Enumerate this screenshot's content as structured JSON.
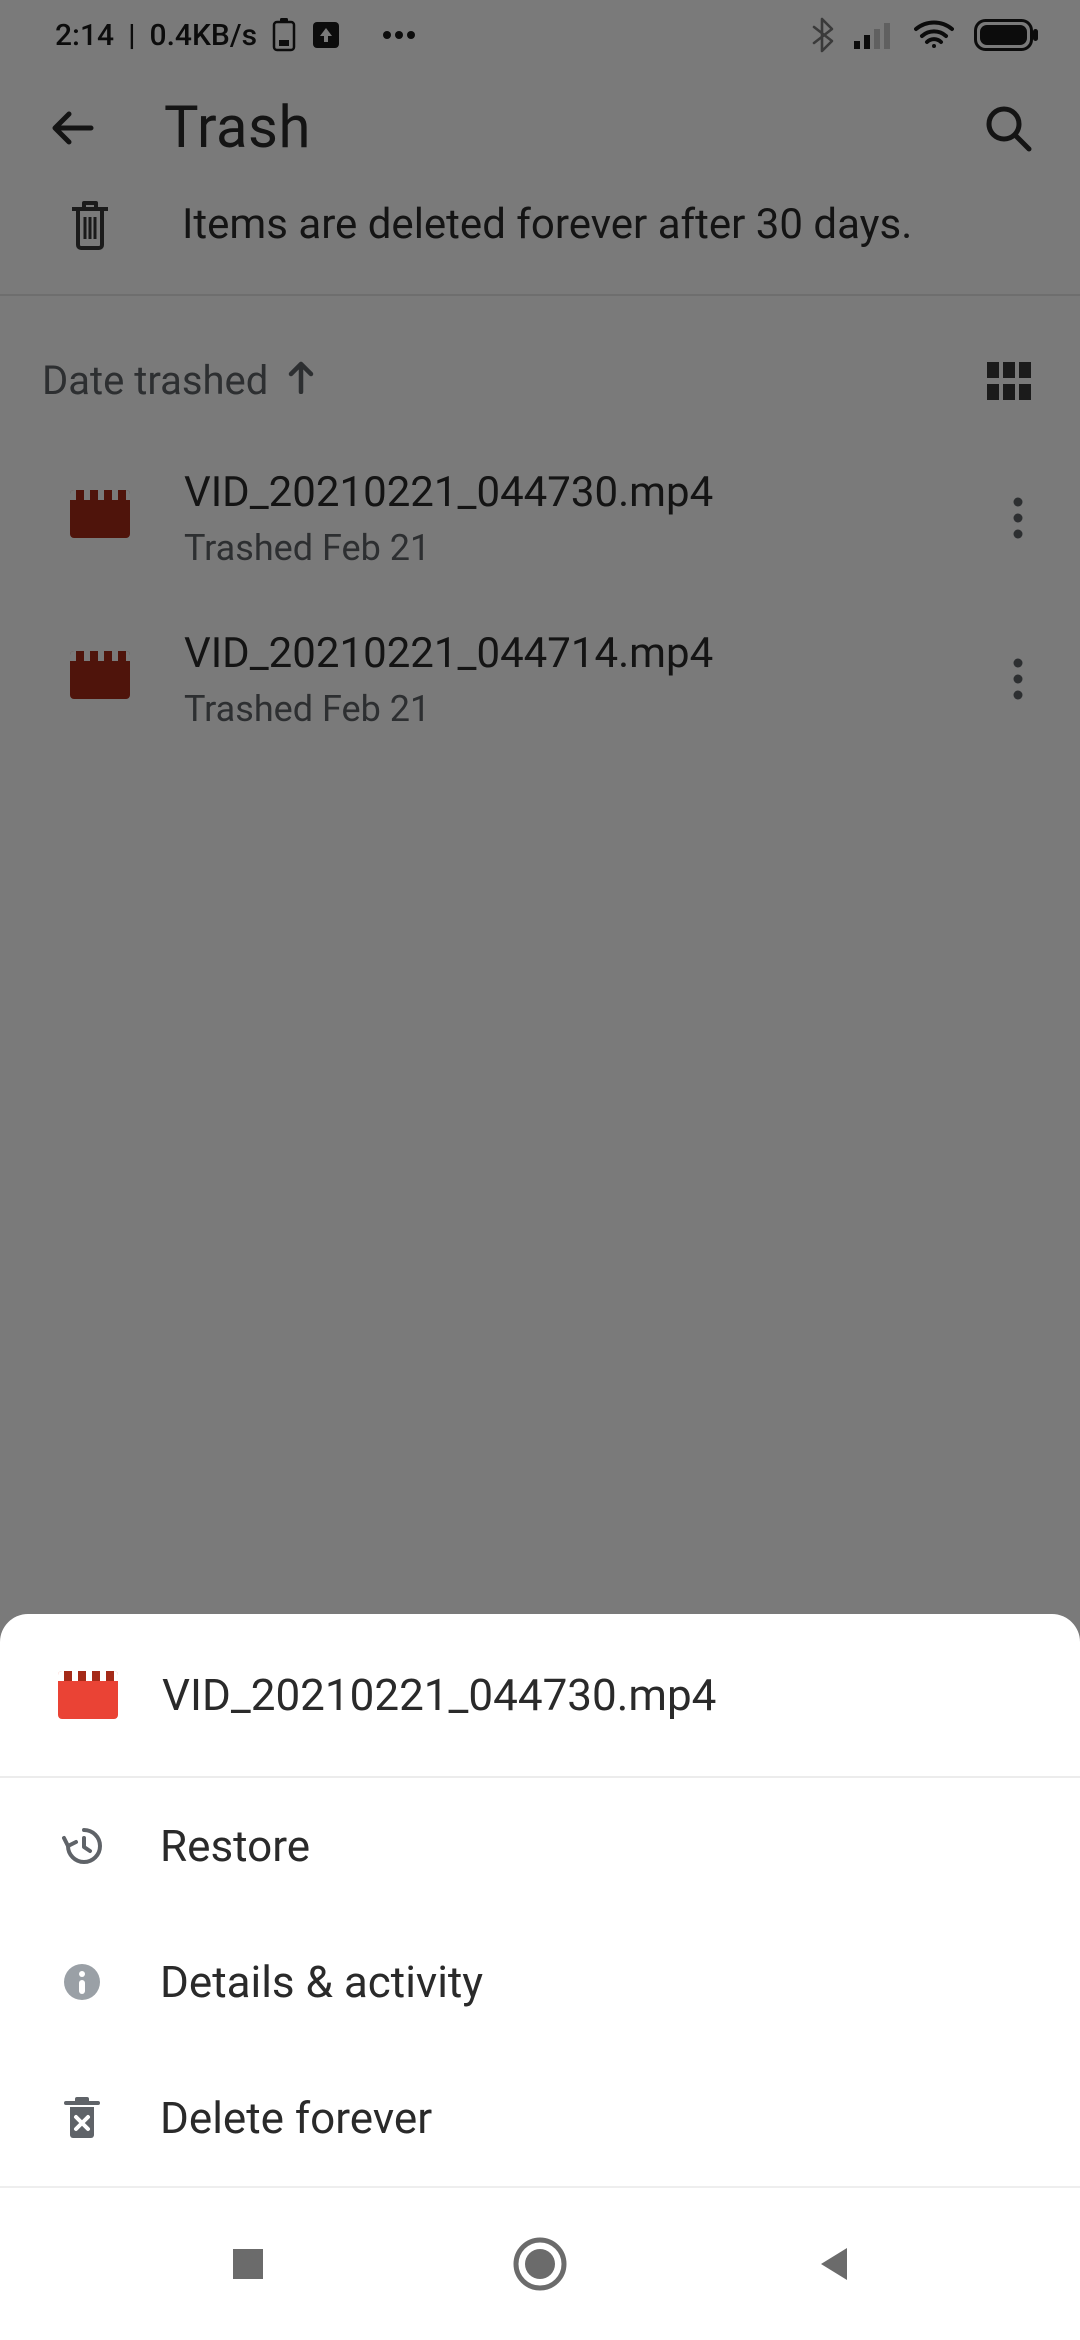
{
  "status": {
    "time": "2:14",
    "net": "0.4KB/s"
  },
  "header": {
    "title": "Trash"
  },
  "banner": {
    "text": "Items are deleted forever after 30 days."
  },
  "sort": {
    "label": "Date trashed"
  },
  "files": [
    {
      "name": "VID_20210221_044730.mp4",
      "sub": "Trashed Feb 21"
    },
    {
      "name": "VID_20210221_044714.mp4",
      "sub": "Trashed Feb 21"
    }
  ],
  "sheet": {
    "title": "VID_20210221_044730.mp4",
    "actions": {
      "restore": "Restore",
      "details": "Details & activity",
      "delete": "Delete forever"
    }
  }
}
